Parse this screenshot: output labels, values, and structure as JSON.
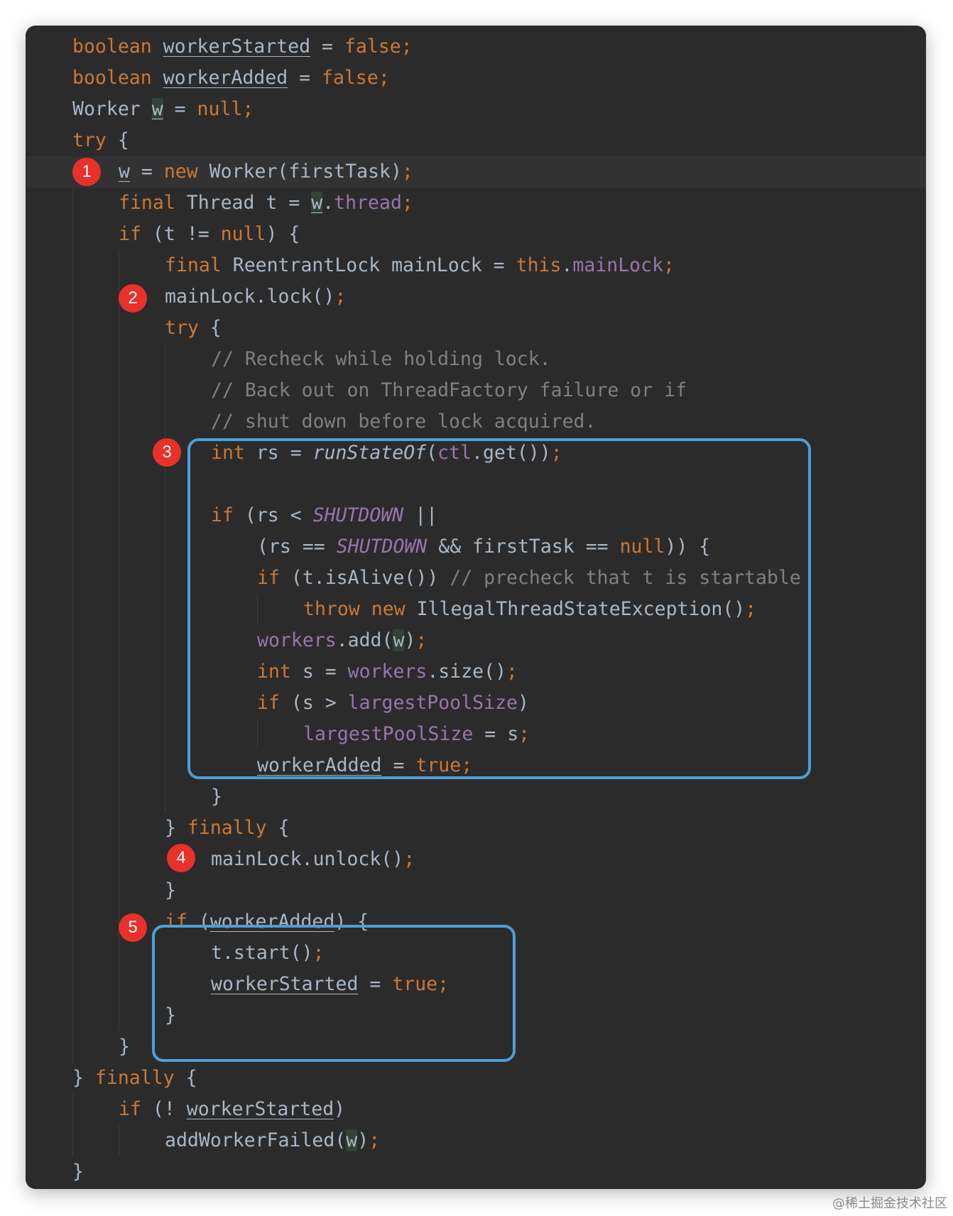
{
  "colors": {
    "background": "#2b2b2b",
    "keyword": "#cc7832",
    "field": "#9876aa",
    "comment": "#808080",
    "default_text": "#a9b7c6",
    "marker": "#e8312a",
    "highlight_box": "#4a9fd8"
  },
  "markers": [
    "1",
    "2",
    "3",
    "4",
    "5"
  ],
  "code": {
    "lines": [
      [
        "boolean",
        " ",
        "workerStarted",
        " = ",
        "false",
        ";"
      ],
      [
        "boolean",
        " ",
        "workerAdded",
        " = ",
        "false",
        ";"
      ],
      [
        "Worker ",
        "w",
        " = ",
        "null",
        ";"
      ],
      [
        "try",
        " {"
      ],
      [
        "w",
        " = ",
        "new",
        " Worker(firstTask)",
        ";"
      ],
      [
        "final",
        " Thread t = ",
        "w",
        ".",
        "thread",
        ";"
      ],
      [
        "if",
        " (t != ",
        "null",
        ") {"
      ],
      [
        "final",
        " ReentrantLock mainLock = ",
        "this",
        ".",
        "mainLock",
        ";"
      ],
      [
        "mainLock.lock()",
        ";"
      ],
      [
        "try",
        " {"
      ],
      [
        "// Recheck while holding lock."
      ],
      [
        "// Back out on ThreadFactory failure or if"
      ],
      [
        "// shut down before lock acquired."
      ],
      [
        "int",
        " rs = ",
        "runStateOf",
        "(",
        "ctl",
        ".get())",
        ";"
      ],
      [
        ""
      ],
      [
        "if",
        " (rs < ",
        "SHUTDOWN",
        " ||"
      ],
      [
        "(rs == ",
        "SHUTDOWN",
        " && firstTask == ",
        "null",
        ")) {"
      ],
      [
        "if",
        " (t.isAlive()) ",
        "// precheck that t is startable"
      ],
      [
        "throw",
        " ",
        "new",
        " IllegalThreadStateException()",
        ";"
      ],
      [
        "workers",
        ".add(",
        "w",
        ")",
        ";"
      ],
      [
        "int",
        " s = ",
        "workers",
        ".size()",
        ";"
      ],
      [
        "if",
        " (s > ",
        "largestPoolSize",
        ")"
      ],
      [
        "largestPoolSize",
        " = s",
        ";"
      ],
      [
        "workerAdded",
        " = ",
        "true",
        ";"
      ],
      [
        "}"
      ],
      [
        "} ",
        "finally",
        " {"
      ],
      [
        "mainLock.unlock()",
        ";"
      ],
      [
        "}"
      ],
      [
        "if",
        " (",
        "workerAdded",
        ") {"
      ],
      [
        "t.start()",
        ";"
      ],
      [
        "workerStarted",
        " = ",
        "true",
        ";"
      ],
      [
        "}"
      ],
      [
        "}"
      ],
      [
        "} ",
        "finally",
        " {"
      ],
      [
        "if",
        " (! ",
        "workerStarted",
        ")"
      ],
      [
        "addWorkerFailed(",
        "w",
        ")",
        ";"
      ],
      [
        "}"
      ]
    ]
  },
  "watermark": "@稀土掘金技术社区"
}
